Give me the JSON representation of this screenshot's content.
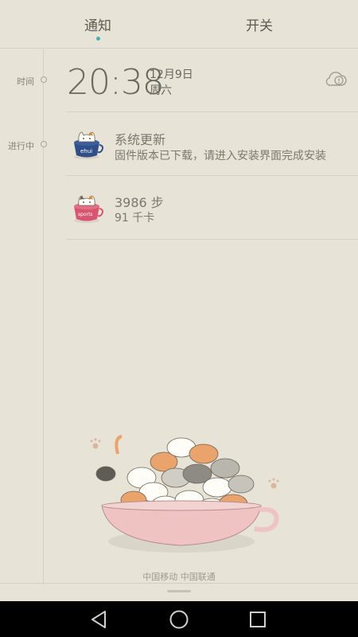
{
  "tabs": {
    "notify_label": "通知",
    "switch_label": "开关",
    "active": "通知"
  },
  "timeline": {
    "time_label": "时间",
    "ongoing_label": "进行中"
  },
  "clock": {
    "time": "20:38",
    "date": "12月9日",
    "weekday": "周六",
    "weather_icon": "cloud-alert-icon"
  },
  "notifications": [
    {
      "title": "系统更新",
      "subtitle": "固件版本已下载，请进入安装界面完成安装",
      "icon": "cat-cup-blue-icon",
      "icon_text": "ehui"
    },
    {
      "title": "3986 步",
      "subtitle": "91 千卡",
      "icon": "cat-cup-pink-icon",
      "icon_text": "sports"
    }
  ],
  "illustration": "cats-in-teacup",
  "carrier": "中国移动   中国联通",
  "navbar": {
    "back_icon": "back-triangle-icon",
    "home_icon": "home-circle-icon",
    "recents_icon": "recents-square-icon"
  },
  "colors": {
    "background": "#e7e3d7",
    "accent_dot": "#3fb5b0",
    "navbar": "#000000"
  }
}
